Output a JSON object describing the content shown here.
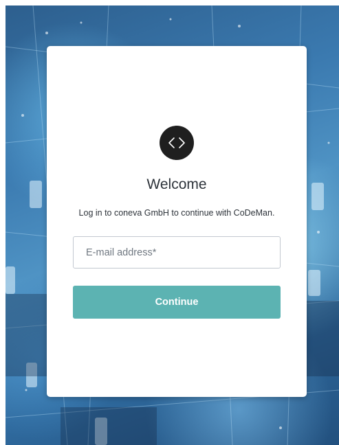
{
  "logo": {
    "icon": "code-brackets-icon"
  },
  "login": {
    "title": "Welcome",
    "subtitle": "Log in to coneva GmbH to continue with CoDeMan.",
    "email_placeholder": "E-mail address*",
    "email_value": "",
    "continue_label": "Continue"
  },
  "colors": {
    "button": "#5cb3b2",
    "logo_bg": "#1f1f1f",
    "text": "#2d333a"
  }
}
